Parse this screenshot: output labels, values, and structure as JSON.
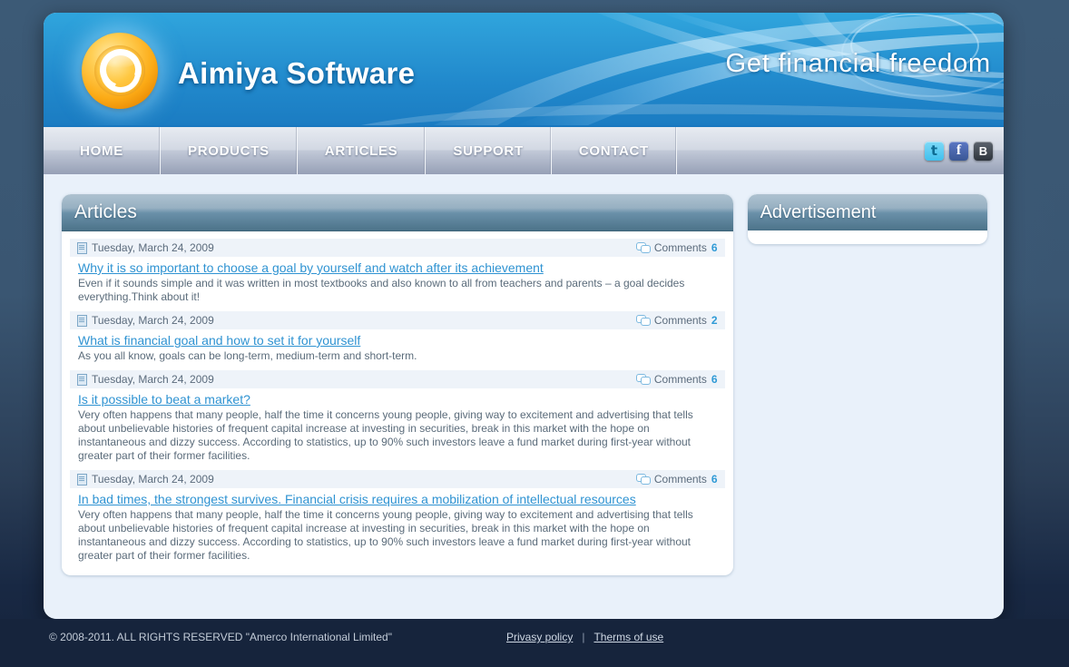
{
  "header": {
    "brand": "Aimiya Software",
    "tagline": "Get financial freedom",
    "logo_icon": "aimiya-circle-logo"
  },
  "nav": {
    "items": [
      {
        "label": "HOME",
        "name": "home"
      },
      {
        "label": "PRODUCTS",
        "name": "products"
      },
      {
        "label": "ARTICLES",
        "name": "articles"
      },
      {
        "label": "SUPPORT",
        "name": "support"
      },
      {
        "label": "CONTACT",
        "name": "contact"
      }
    ],
    "social": [
      {
        "glyph": "t",
        "name": "twitter-icon"
      },
      {
        "glyph": "f",
        "name": "facebook-icon"
      },
      {
        "glyph": "B",
        "name": "vkontakte-icon"
      }
    ]
  },
  "main": {
    "panel_title": "Articles",
    "comments_label": "Comments",
    "date_icon": "document-icon",
    "comments_icon": "speech-bubbles-icon",
    "articles": [
      {
        "date": "Tuesday, March 24, 2009",
        "comments": "6",
        "title": "Why it is so important to choose a goal by yourself and watch after its achievement",
        "excerpt": "Even if it sounds simple and it was written in most textbooks and also known to all from teachers and parents – a goal decides everything.Think about it!"
      },
      {
        "date": "Tuesday, March 24, 2009",
        "comments": "2",
        "title": "What is financial goal and how to set it for yourself",
        "excerpt": "As you all know, goals can be long-term, medium-term and short-term."
      },
      {
        "date": "Tuesday, March 24, 2009",
        "comments": "6",
        "title": "Is it possible to beat a market?",
        "excerpt": "Very often happens that many people, half the time it concerns young people, giving way to excitement and advertising that tells about unbelievable histories of frequent capital increase at investing in securities, break in this market with the hope on instantaneous and dizzy success. According to statistics, up to 90% such investors leave a fund market during first-year without greater part of their former facilities."
      },
      {
        "date": "Tuesday, March 24, 2009",
        "comments": "6",
        "title": "In bad times, the strongest survives. Financial crisis requires a mobilization of intellectual resources",
        "excerpt": "Very often happens that many people, half the time it concerns young people, giving way to excitement and advertising that tells about unbelievable histories of frequent capital increase at investing in securities, break in this market with the hope on instantaneous and dizzy success. According to statistics, up to 90% such investors leave a fund market during first-year without greater part of their former facilities."
      }
    ]
  },
  "sidebar": {
    "ad_title": "Advertisement"
  },
  "footer": {
    "copyright": "© 2008-2011. ALL RIGHTS RESERVED \"Amerco International Limited\"",
    "privacy_label": "Privasy policy",
    "separator": "|",
    "terms_label": "Therms of use"
  },
  "colors": {
    "accent_blue": "#2f93d2",
    "banner_blue": "#2189cc",
    "panel_header_dark": "#4c7389",
    "footer_bg": "#16243c",
    "logo_orange": "#f9a713"
  }
}
